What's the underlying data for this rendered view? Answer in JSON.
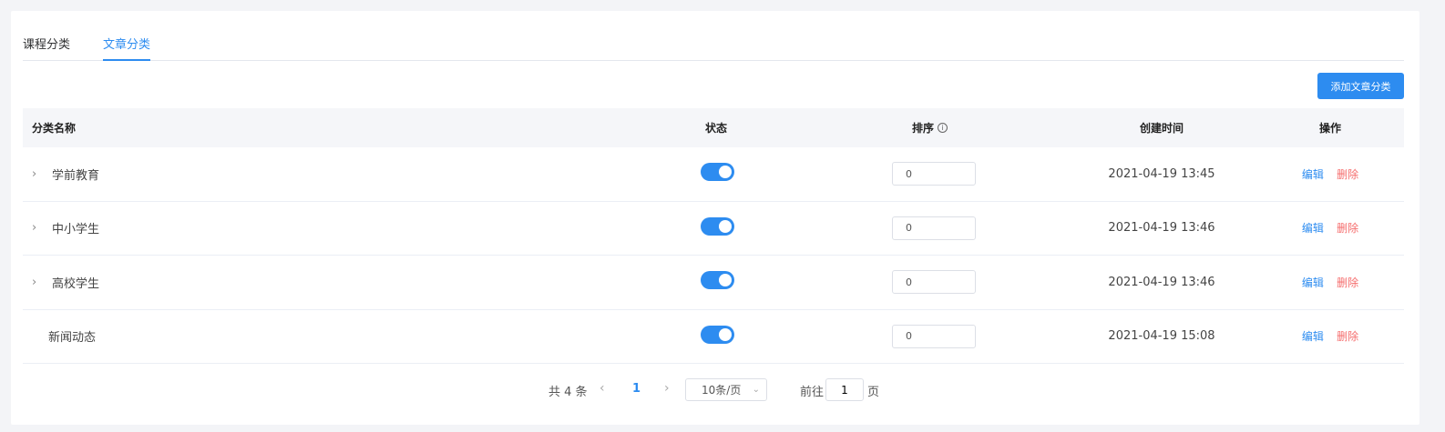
{
  "tabs": [
    {
      "label": "课程分类",
      "active": false
    },
    {
      "label": "文章分类",
      "active": true
    }
  ],
  "add_button_label": "添加文章分类",
  "table": {
    "headers": {
      "name": "分类名称",
      "status": "状态",
      "sort": "排序",
      "time": "创建时间",
      "op": "操作"
    },
    "rows": [
      {
        "name": "学前教育",
        "expandable": true,
        "status": true,
        "sort": "0",
        "time": "2021-04-19 13:45"
      },
      {
        "name": "中小学生",
        "expandable": true,
        "status": true,
        "sort": "0",
        "time": "2021-04-19 13:46"
      },
      {
        "name": "高校学生",
        "expandable": true,
        "status": true,
        "sort": "0",
        "time": "2021-04-19 13:46"
      },
      {
        "name": "新闻动态",
        "expandable": false,
        "status": true,
        "sort": "0",
        "time": "2021-04-19 15:08"
      }
    ],
    "edit_label": "编辑",
    "delete_label": "删除"
  },
  "pagination": {
    "total_label": "共 4 条",
    "current_page": "1",
    "page_size": "10条/页",
    "goto_label": "前往",
    "goto_value": "1",
    "page_suffix": "页"
  },
  "colors": {
    "accent": "#2d8cf0",
    "danger": "#f56c6c"
  }
}
